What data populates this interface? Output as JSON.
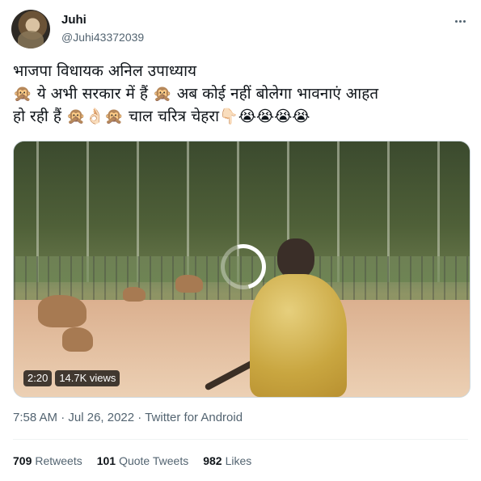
{
  "author": {
    "name": "Juhi",
    "handle": "@Juhi43372039"
  },
  "tweet": {
    "line1": "भाजपा विधायक अनिल उपाध्याय",
    "line2_a": "🙊 ये अभी सरकार में हैं 🙊 अब कोई नहीं बोलेगा भावनाएं आहत",
    "line3_a": "हो रही हैं 🙊👌🏻🙊 चाल चरित्र चेहरा👇🏻😭😭😭😭"
  },
  "video": {
    "duration": "2:20",
    "views": "14.7K views"
  },
  "meta": {
    "time": "7:58 AM",
    "separator1": " · ",
    "date": "Jul 26, 2022",
    "separator2": " · ",
    "source": "Twitter for Android"
  },
  "stats": {
    "retweets_count": "709",
    "retweets_label": "Retweets",
    "quotes_count": "101",
    "quotes_label": "Quote Tweets",
    "likes_count": "982",
    "likes_label": "Likes"
  },
  "icons": {
    "more": "more-horizontal-icon",
    "loading": "loading-spinner-icon"
  }
}
